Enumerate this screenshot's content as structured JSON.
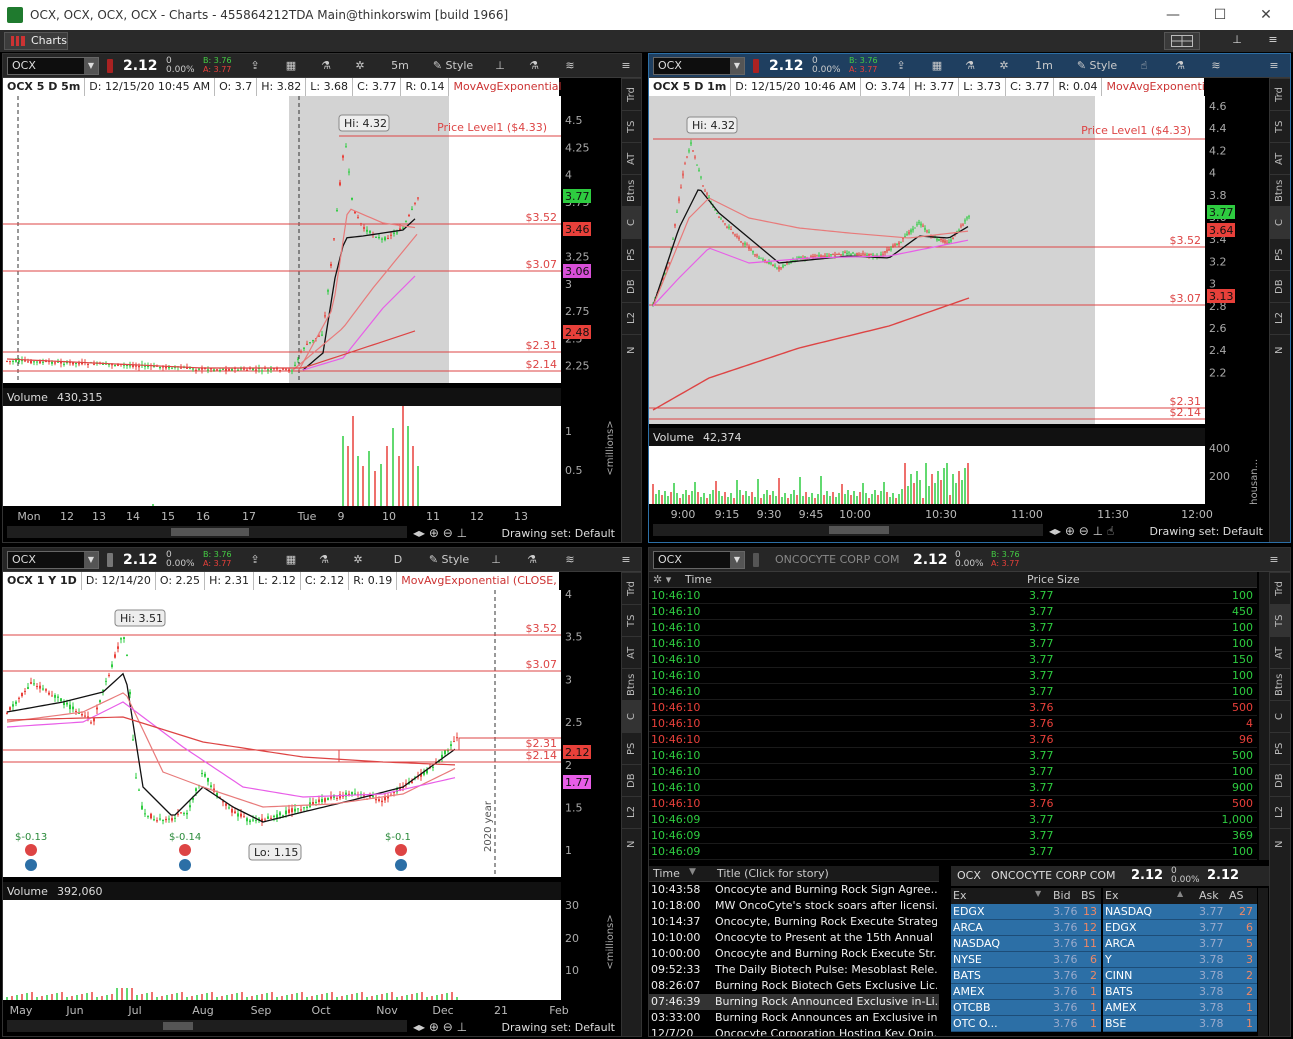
{
  "window": {
    "title": "OCX, OCX, OCX, OCX - Charts - 455864212TDA Main@thinkorswim [build 1966]",
    "minimize": "—",
    "maximize": "☐",
    "close": "✕"
  },
  "menubar": {
    "charts_tab": "Charts",
    "layout_icon": "grid-layout-icon",
    "pin": "⊥",
    "menu": "≡"
  },
  "toolbar_labels": {
    "style": "Style",
    "share": "⇪",
    "gear": "✲",
    "flask": "⚗",
    "hand": "☝",
    "drawing_set": "Drawing set: Default"
  },
  "colors": {
    "up": "#2ecc40",
    "down": "#e8403a",
    "ema": "#e87a7a",
    "sma": "#e85de8",
    "bid_bg": "#2c6fa6",
    "bg": "#000000"
  },
  "chart1": {
    "symbol": "OCX",
    "price": "2.12",
    "change": "0",
    "change_pct": "0.00%",
    "bid": "B: 3.76",
    "ask": "A: 3.77",
    "timeframe": "5m",
    "info": {
      "name": "OCX 5 D 5m",
      "date": "D: 12/15/20 10:45 AM",
      "open": "O: 3.7",
      "high": "H: 3.82",
      "low": "L: 3.68",
      "close": "C: 3.77",
      "range": "R: 0.14",
      "study": "MovAvgExponential ..."
    },
    "annotations": {
      "hi": "Hi: 4.32",
      "price_level": "Price Level1 ($4.33)"
    },
    "level_labels": [
      "$3.52",
      "$3.07",
      "$2.31",
      "$2.14"
    ],
    "price_ticks": [
      "4.5",
      "4.25",
      "4",
      "3.75",
      "3.5",
      "3.25",
      "3",
      "2.75",
      "2.5",
      "2.25"
    ],
    "price_tags": [
      {
        "text": "3.77",
        "color": "#2ecc40"
      },
      {
        "text": "3.46",
        "color": "#e8403a"
      },
      {
        "text": "3.06",
        "color": "#d84fd8"
      },
      {
        "text": "2.48",
        "color": "#e8403a"
      }
    ],
    "volume_label": "Volume",
    "volume_value": "430,315",
    "volume_ticks": [
      "1",
      "0.5"
    ],
    "volume_unit": "<millions>",
    "x_ticks": [
      "Mon",
      "12",
      "13",
      "14",
      "15",
      "16",
      "17",
      "Tue",
      "9",
      "10",
      "11",
      "12",
      "13"
    ]
  },
  "chart2": {
    "symbol": "OCX",
    "price": "2.12",
    "change": "0",
    "change_pct": "0.00%",
    "bid": "B: 3.76",
    "ask": "A: 3.77",
    "timeframe": "1m",
    "info": {
      "name": "OCX 5 D 1m",
      "date": "D: 12/15/20 10:46 AM",
      "open": "O: 3.74",
      "high": "H: 3.77",
      "low": "L: 3.73",
      "close": "C: 3.77",
      "range": "R: 0.04",
      "study": "MovAvgExponential ..."
    },
    "annotations": {
      "hi": "Hi: 4.32",
      "price_level": "Price Level1 ($4.33)"
    },
    "level_labels": [
      "$3.52",
      "$3.07",
      "$2.31",
      "$2.14"
    ],
    "price_ticks": [
      "4.6",
      "4.4",
      "4.2",
      "4",
      "3.8",
      "3.6",
      "3.4",
      "3.2",
      "3",
      "2.8",
      "2.6",
      "2.4",
      "2.2"
    ],
    "price_tags": [
      {
        "text": "3.77",
        "color": "#2ecc40"
      },
      {
        "text": "3.64",
        "color": "#e8403a"
      },
      {
        "text": "3.13",
        "color": "#e8403a"
      }
    ],
    "volume_label": "Volume",
    "volume_value": "42,374",
    "volume_ticks": [
      "400",
      "200"
    ],
    "volume_unit": "<thousan...",
    "x_ticks": [
      "9:00",
      "9:15",
      "9:30",
      "9:45",
      "10:00",
      "10:30",
      "11:00",
      "11:30",
      "12:00"
    ]
  },
  "chart3": {
    "symbol": "OCX",
    "price": "2.12",
    "change": "0",
    "change_pct": "0.00%",
    "bid": "B: 3.76",
    "ask": "A: 3.77",
    "timeframe": "D",
    "info": {
      "name": "OCX 1 Y 1D",
      "date": "D: 12/14/20",
      "open": "O: 2.25",
      "high": "H: 2.31",
      "low": "L: 2.12",
      "close": "C: 2.12",
      "range": "R: 0.19",
      "study": "MovAvgExponential (CLOSE, 20, 0,..."
    },
    "annotations": {
      "hi": "Hi: 3.51",
      "lo": "Lo: 1.15",
      "year": "2020 year"
    },
    "earnings": [
      "$-0.13",
      "$-0.14",
      "$-0.1"
    ],
    "level_labels": [
      "$3.52",
      "$3.07",
      "$2.31",
      "$2.14"
    ],
    "price_ticks": [
      "4",
      "3.5",
      "3",
      "2.5",
      "2",
      "1.5",
      "1"
    ],
    "price_tags": [
      {
        "text": "2.12",
        "color": "#e8403a"
      },
      {
        "text": "1.77",
        "color": "#e85de8"
      }
    ],
    "volume_label": "Volume",
    "volume_value": "392,060",
    "volume_ticks": [
      "30",
      "20",
      "10"
    ],
    "volume_unit": "<millions>",
    "x_ticks": [
      "May",
      "Jun",
      "Jul",
      "Aug",
      "Sep",
      "Oct",
      "Nov",
      "Dec",
      "21",
      "Feb"
    ]
  },
  "side_tabs": [
    "Trd",
    "TS",
    "AT",
    "Btns",
    "C",
    "PS",
    "DB",
    "L2",
    "N"
  ],
  "time_sales": {
    "symbol": "OCX",
    "company": "ONCOCYTE CORP COM",
    "price": "2.12",
    "change": "0",
    "change_pct": "0.00%",
    "bid": "B: 3.76",
    "ask": "A: 3.77",
    "headers": {
      "time": "Time",
      "price": "Price",
      "size": "Size"
    },
    "rows": [
      {
        "time": "10:46:10",
        "price": "3.77",
        "size": "100",
        "side": "up"
      },
      {
        "time": "10:46:10",
        "price": "3.77",
        "size": "450",
        "side": "up"
      },
      {
        "time": "10:46:10",
        "price": "3.77",
        "size": "100",
        "side": "up"
      },
      {
        "time": "10:46:10",
        "price": "3.77",
        "size": "100",
        "side": "up"
      },
      {
        "time": "10:46:10",
        "price": "3.77",
        "size": "150",
        "side": "up"
      },
      {
        "time": "10:46:10",
        "price": "3.77",
        "size": "100",
        "side": "up"
      },
      {
        "time": "10:46:10",
        "price": "3.77",
        "size": "100",
        "side": "up"
      },
      {
        "time": "10:46:10",
        "price": "3.76",
        "size": "500",
        "side": "down"
      },
      {
        "time": "10:46:10",
        "price": "3.76",
        "size": "4",
        "side": "down"
      },
      {
        "time": "10:46:10",
        "price": "3.76",
        "size": "96",
        "side": "down"
      },
      {
        "time": "10:46:10",
        "price": "3.77",
        "size": "500",
        "side": "up"
      },
      {
        "time": "10:46:10",
        "price": "3.77",
        "size": "100",
        "side": "up"
      },
      {
        "time": "10:46:10",
        "price": "3.77",
        "size": "900",
        "side": "up"
      },
      {
        "time": "10:46:10",
        "price": "3.76",
        "size": "500",
        "side": "down"
      },
      {
        "time": "10:46:09",
        "price": "3.77",
        "size": "1,000",
        "side": "up"
      },
      {
        "time": "10:46:09",
        "price": "3.77",
        "size": "369",
        "side": "up"
      },
      {
        "time": "10:46:09",
        "price": "3.77",
        "size": "100",
        "side": "up"
      }
    ]
  },
  "news": {
    "headers": {
      "time": "Time",
      "title": "Title (Click for story)"
    },
    "rows": [
      {
        "time": "10:43:58",
        "title": "Oncocyte and Burning Rock Sign Agree..."
      },
      {
        "time": "10:18:00",
        "title": "MW OncoCyte's stock soars after licensi..."
      },
      {
        "time": "10:14:37",
        "title": "Oncocyte, Burning Rock Execute Strategi..."
      },
      {
        "time": "10:10:00",
        "title": "Oncocyte to Present at the 15th Annual ..."
      },
      {
        "time": "10:00:00",
        "title": "Oncocyte and Burning Rock Execute Str..."
      },
      {
        "time": "09:52:33",
        "title": "The Daily Biotech Pulse: Mesoblast Rele..."
      },
      {
        "time": "08:26:07",
        "title": "Burning Rock Biotech Gets Exclusive Lic..."
      },
      {
        "time": "07:46:39",
        "title": "Burning Rock Announced Exclusive in-Li..."
      },
      {
        "time": "03:33:00",
        "title": "Burning Rock Announces an Exclusive in..."
      },
      {
        "time": "12/7/20",
        "title": "Oncocyte Corporation Hosting Key Opin..."
      }
    ]
  },
  "level2": {
    "symbol": "OCX",
    "company": "ONCOCYTE CORP COM",
    "price": "2.12",
    "change": "0",
    "change_pct": "0.00%",
    "bid_headers": {
      "ex": "Ex",
      "bid": "Bid",
      "bs": "BS"
    },
    "ask_headers": {
      "ex": "Ex",
      "ask": "Ask",
      "as": "AS"
    },
    "bids": [
      {
        "ex": "EDGX",
        "price": "3.76",
        "size": "13"
      },
      {
        "ex": "ARCA",
        "price": "3.76",
        "size": "12"
      },
      {
        "ex": "NASDAQ",
        "price": "3.76",
        "size": "11"
      },
      {
        "ex": "NYSE",
        "price": "3.76",
        "size": "6"
      },
      {
        "ex": "BATS",
        "price": "3.76",
        "size": "2"
      },
      {
        "ex": "AMEX",
        "price": "3.76",
        "size": "1"
      },
      {
        "ex": "OTCBB",
        "price": "3.76",
        "size": "1"
      },
      {
        "ex": "OTC O...",
        "price": "3.76",
        "size": "1"
      }
    ],
    "asks": [
      {
        "ex": "NASDAQ",
        "price": "3.77",
        "size": "27"
      },
      {
        "ex": "EDGX",
        "price": "3.77",
        "size": "6"
      },
      {
        "ex": "ARCA",
        "price": "3.77",
        "size": "5"
      },
      {
        "ex": "Y",
        "price": "3.78",
        "size": "3"
      },
      {
        "ex": "CINN",
        "price": "3.78",
        "size": "2"
      },
      {
        "ex": "BATS",
        "price": "3.78",
        "size": "2"
      },
      {
        "ex": "AMEX",
        "price": "3.78",
        "size": "1"
      },
      {
        "ex": "BSE",
        "price": "3.78",
        "size": "1"
      }
    ]
  }
}
